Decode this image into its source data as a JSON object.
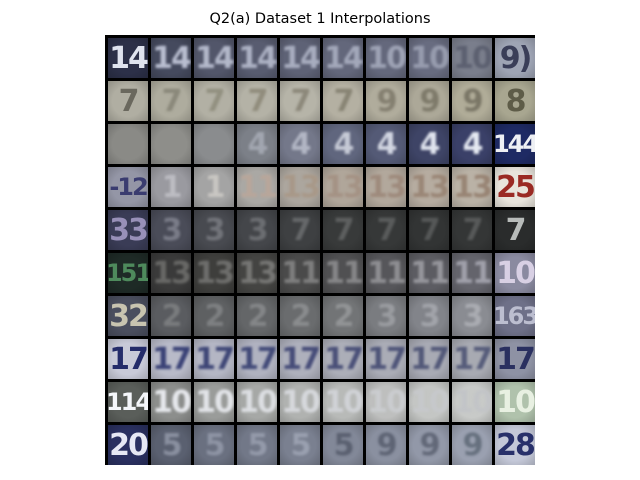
{
  "title": "Q2(a) Dataset 1 Interpolations",
  "grid": {
    "rows": [
      {
        "bg": [
          "#2c3048",
          "#454a5e",
          "#52566a",
          "#585c70",
          "#5e6276",
          "#63677b",
          "#64687c",
          "#686c80",
          "#7a7e8c",
          "#9ea4b4"
        ],
        "fg": [
          "#dfe3ee",
          "#b9bed0",
          "#b3b8ca",
          "#adb2c4",
          "#a8adbf",
          "#a3a8ba",
          "#9ea3b5",
          "#979cae",
          "#5c6070",
          "#3a3e58"
        ],
        "text": [
          "14",
          "14",
          "14",
          "14",
          "14",
          "14",
          "10",
          "10",
          "10",
          "9)"
        ],
        "soft": [
          false,
          true,
          true,
          true,
          true,
          true,
          true,
          true,
          true,
          false
        ]
      },
      {
        "bg": [
          "#b0aea2",
          "#aeac9e",
          "#b2b0a4",
          "#b4b2a6",
          "#b6b4a8",
          "#b4b0a2",
          "#b0ac9c",
          "#aca898",
          "#b0ac98",
          "#a8a690"
        ],
        "fg": [
          "#6a685e",
          "#8a887a",
          "#929080",
          "#908c7c",
          "#8c887a",
          "#888474",
          "#847f70",
          "#7e7a6a",
          "#7a7666",
          "#5e5c48"
        ],
        "text": [
          "7",
          "7",
          "7",
          "7",
          "7",
          "7",
          "9",
          "9",
          "9",
          "8"
        ],
        "soft": [
          false,
          true,
          true,
          true,
          true,
          true,
          true,
          true,
          true,
          false
        ]
      },
      {
        "bg": [
          "#8a8a86",
          "#8e8e8a",
          "#8a8c8e",
          "#7c8088",
          "#74788a",
          "#60667e",
          "#545a76",
          "#3e4466",
          "#3a4068",
          "#1e2a64"
        ],
        "fg": [
          "#7e7e7a",
          "#7e7e7c",
          "#9a9ca0",
          "#a2a6b0",
          "#b2b6c4",
          "#c6cad6",
          "#d2d6e2",
          "#e0e4ee",
          "#e6eaf2",
          "#eef0f4"
        ],
        "text": [
          "",
          "",
          "",
          "4",
          "4",
          "4",
          "4",
          "4",
          "4",
          "144"
        ],
        "soft": [
          false,
          true,
          true,
          true,
          true,
          true,
          true,
          true,
          true,
          false
        ]
      },
      {
        "bg": [
          "#9496a6",
          "#9a9aa0",
          "#a4a4a4",
          "#aaa8a4",
          "#aca69e",
          "#b0a69a",
          "#b2a89c",
          "#b6aca0",
          "#bab2a6",
          "#e8e4dc"
        ],
        "fg": [
          "#3a3c70",
          "#bcbcc2",
          "#c8c6c2",
          "#b8a69a",
          "#a89888",
          "#a49284",
          "#9e8a7c",
          "#9a8676",
          "#988474",
          "#9a2a24"
        ],
        "text": [
          "-12",
          "1",
          "1",
          "11",
          "13",
          "13",
          "13",
          "13",
          "13",
          "25"
        ],
        "soft": [
          false,
          true,
          true,
          true,
          true,
          true,
          true,
          true,
          true,
          false
        ]
      },
      {
        "bg": [
          "#3a3c56",
          "#4a4c58",
          "#484a50",
          "#44464a",
          "#3e4042",
          "#383a3a",
          "#363838",
          "#323434",
          "#343636",
          "#2a2c2c"
        ],
        "fg": [
          "#9890b8",
          "#7a7c88",
          "#72747a",
          "#6c6e72",
          "#66686a",
          "#5e6060",
          "#5a5c5c",
          "#565858",
          "#585a5a",
          "#b8bcba"
        ],
        "text": [
          "33",
          "3",
          "3",
          "3",
          "7",
          "7",
          "7",
          "7",
          "7",
          "7"
        ],
        "soft": [
          false,
          true,
          true,
          true,
          true,
          true,
          true,
          true,
          true,
          false
        ]
      },
      {
        "bg": [
          "#1e2a26",
          "#3a3a3a",
          "#3e3e3c",
          "#444442",
          "#4a4a4a",
          "#505052",
          "#56565a",
          "#5c5c62",
          "#64646c",
          "#8a8aa0"
        ],
        "fg": [
          "#4e8a5c",
          "#686866",
          "#6e6e6c",
          "#767674",
          "#7e7e7e",
          "#868688",
          "#8e8e92",
          "#96969c",
          "#a0a0aa",
          "#d8d0e4"
        ],
        "text": [
          "151",
          "13",
          "13",
          "13",
          "11",
          "11",
          "11",
          "11",
          "11",
          "10"
        ],
        "soft": [
          false,
          true,
          true,
          true,
          true,
          true,
          true,
          true,
          true,
          false
        ]
      },
      {
        "bg": [
          "#4a4e5e",
          "#5a5c60",
          "#5e6062",
          "#646668",
          "#6a6c6e",
          "#727476",
          "#7a7c80",
          "#82848a",
          "#8a8c92",
          "#6e7088"
        ],
        "fg": [
          "#c8c4b0",
          "#7a7c7e",
          "#7e8082",
          "#848688",
          "#8a8c8e",
          "#929496",
          "#9a9ca0",
          "#a2a4aa",
          "#aaacb2",
          "#bcbed0"
        ],
        "text": [
          "32",
          "2",
          "2",
          "2",
          "2",
          "2",
          "3",
          "3",
          "3",
          "163"
        ],
        "soft": [
          false,
          true,
          true,
          true,
          true,
          true,
          true,
          true,
          true,
          false
        ]
      },
      {
        "bg": [
          "#c8cad8",
          "#b8bac8",
          "#b4b6c4",
          "#b0b2c0",
          "#aeb0bc",
          "#acaeb8",
          "#aaacb6",
          "#a8aab4",
          "#a8aab2",
          "#8e92a4"
        ],
        "fg": [
          "#242c6a",
          "#3a4276",
          "#3e4676",
          "#424a78",
          "#464c78",
          "#4a5078",
          "#4e5478",
          "#525878",
          "#565c7a",
          "#2a3060"
        ],
        "text": [
          "17",
          "17",
          "17",
          "17",
          "17",
          "17",
          "17",
          "17",
          "17",
          "17"
        ],
        "soft": [
          false,
          true,
          true,
          true,
          true,
          true,
          true,
          true,
          true,
          false
        ]
      },
      {
        "bg": [
          "#5a5e5a",
          "#8c8e8c",
          "#9a9c9a",
          "#a6a8a6",
          "#b0b2b0",
          "#b8bab8",
          "#bebfbe",
          "#c4c6c4",
          "#c8cac8",
          "#b0c2ac"
        ],
        "fg": [
          "#f4f6fa",
          "#e6e8ec",
          "#e2e4e8",
          "#dcdee2",
          "#d6d8dc",
          "#d0d2d6",
          "#cacccf",
          "#c6c8cb",
          "#c2c4c7",
          "#e8f0e2"
        ],
        "text": [
          "114",
          "10",
          "10",
          "10",
          "10",
          "10",
          "10",
          "10",
          "10",
          "10"
        ],
        "soft": [
          false,
          true,
          true,
          true,
          true,
          true,
          true,
          true,
          true,
          false
        ]
      },
      {
        "bg": [
          "#2a3060",
          "#5a6070",
          "#6a7080",
          "#727888",
          "#7a8090",
          "#828898",
          "#8a90a0",
          "#9298a8",
          "#9aa0b0",
          "#c4c8d8"
        ],
        "fg": [
          "#e6e8f4",
          "#8a90a0",
          "#8e94a4",
          "#949aaa",
          "#9aa0b0",
          "#5a6070",
          "#5e6474",
          "#626878",
          "#66707e",
          "#28306a"
        ],
        "text": [
          "20",
          "5",
          "5",
          "5",
          "5",
          "5",
          "9",
          "9",
          "9",
          "28"
        ],
        "soft": [
          false,
          true,
          true,
          true,
          true,
          true,
          true,
          true,
          true,
          false
        ]
      }
    ]
  }
}
